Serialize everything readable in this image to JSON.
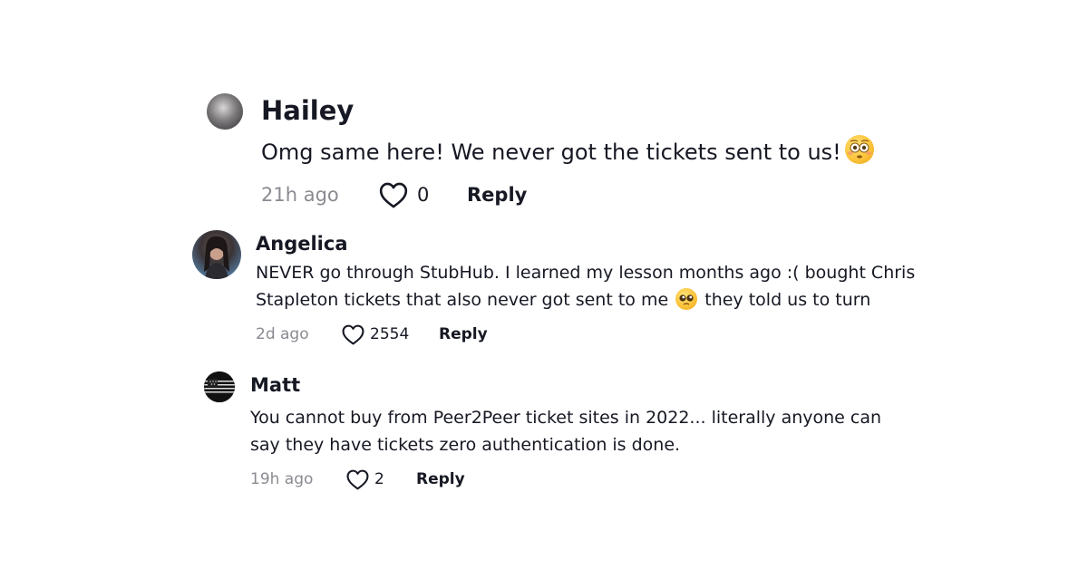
{
  "comments": [
    {
      "name": "Hailey",
      "text": "Omg same here! We never got the tickets sent to us!",
      "emoji": "flushed-face",
      "time": "21h ago",
      "likes": "0",
      "reply_label": "Reply"
    },
    {
      "name": "Angelica",
      "text_before_emoji": "NEVER go through StubHub. I learned my lesson months ago :( bought Chris Stapleton tickets that also never got sent to me",
      "emoji": "pleading-face",
      "text_after_emoji": "they told us to turn",
      "time": "2d ago",
      "likes": "2554",
      "reply_label": "Reply"
    },
    {
      "name": "Matt",
      "text": "You cannot buy from Peer2Peer ticket sites in 2022... literally anyone can say they have tickets zero authentication is done.",
      "time": "19h ago",
      "likes": "2",
      "reply_label": "Reply"
    }
  ],
  "icons": {
    "like": "heart-outline-icon"
  },
  "colors": {
    "text": "#161823",
    "muted": "#8a8b91",
    "background": "#ffffff"
  }
}
